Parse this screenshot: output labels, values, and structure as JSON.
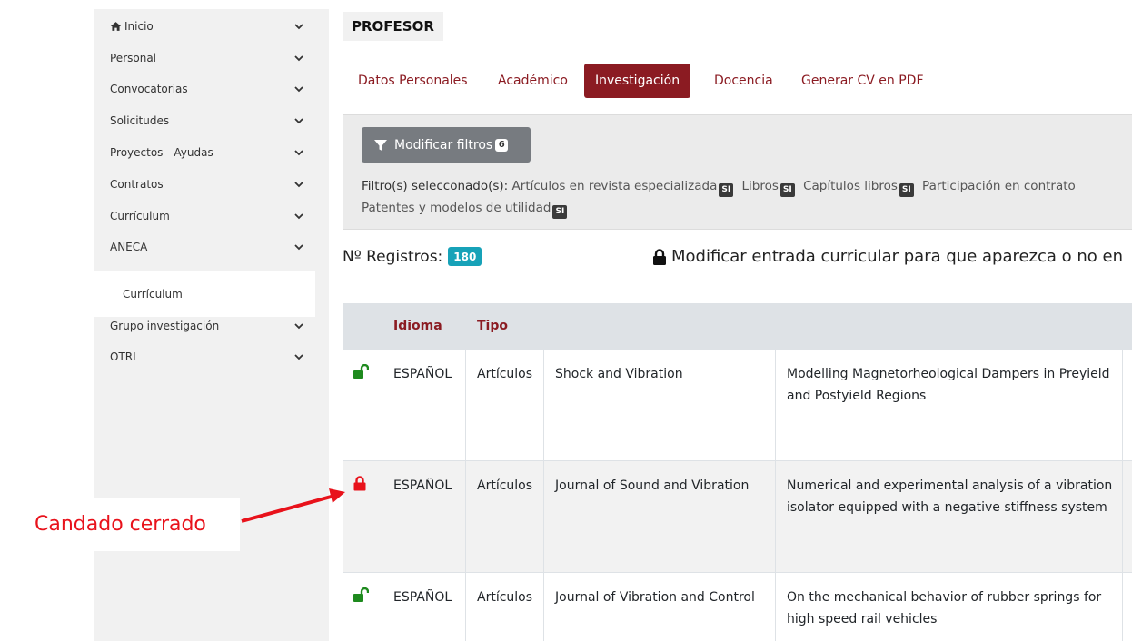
{
  "sidebar": {
    "items": [
      {
        "label": "Inicio",
        "icon": "home-icon"
      },
      {
        "label": "Personal"
      },
      {
        "label": "Convocatorias"
      },
      {
        "label": "Solicitudes"
      },
      {
        "label": "Proyectos - Ayudas"
      },
      {
        "label": "Contratos"
      },
      {
        "label": "Currículum"
      },
      {
        "label": "ANECA"
      },
      {
        "label": "Grupo investigación"
      },
      {
        "label": "OTRI"
      }
    ],
    "subitem": "Currículum"
  },
  "header": {
    "title": "PROFESOR"
  },
  "tabs": [
    {
      "label": "Datos Personales"
    },
    {
      "label": "Académico"
    },
    {
      "label": "Investigación",
      "active": true
    },
    {
      "label": "Docencia"
    },
    {
      "label": "Generar CV en PDF"
    }
  ],
  "filters": {
    "button_label": "Modificar filtros",
    "button_count": "6",
    "prefix": "Filtro(s) selecconado(s):",
    "items": [
      {
        "label": "Artículos en revista especializada",
        "badge": "SI"
      },
      {
        "label": "Libros",
        "badge": "SI"
      },
      {
        "label": "Capítulos libros",
        "badge": "SI"
      },
      {
        "label": "Participación en contrato"
      },
      {
        "label": "Patentes y modelos de utilidad",
        "badge": "SI"
      }
    ]
  },
  "registros": {
    "label": "Nº Registros:",
    "count": "180"
  },
  "lock_notice": "Modificar entrada curricular para que aparezca o no en",
  "table": {
    "headers": {
      "idioma": "Idioma",
      "tipo": "Tipo"
    },
    "rows": [
      {
        "lock": "unlocked",
        "idioma": "ESPAÑOL",
        "tipo": "Artículos",
        "revista": "Shock and Vibration",
        "titulo": "Modelling Magnetorheological Dampers in Preyield and Postyield Regions"
      },
      {
        "lock": "locked",
        "idioma": "ESPAÑOL",
        "tipo": "Artículos",
        "revista": "Journal of Sound and Vibration",
        "titulo": "Numerical and experimental analysis of a vibration isolator equipped with a negative stiffness system"
      },
      {
        "lock": "unlocked",
        "idioma": "ESPAÑOL",
        "tipo": "Artículos",
        "revista": "Journal of Vibration and Control",
        "titulo": "On the mechanical behavior of rubber springs for high speed rail vehicles"
      }
    ]
  },
  "annotation": {
    "label": "Candado cerrado"
  },
  "colors": {
    "accent": "#8b1b22",
    "unlocked": "#1e8a1e",
    "locked": "#e8121b",
    "badge": "#17a2b8"
  }
}
